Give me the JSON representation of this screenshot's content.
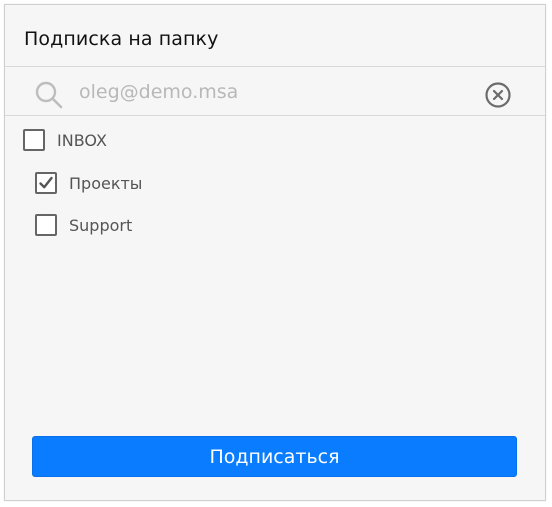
{
  "dialog": {
    "title": "Подписка на папку"
  },
  "search": {
    "value": "oleg@demo.msa",
    "icon": "search-icon",
    "clear_icon": "clear-circle-icon"
  },
  "folders": [
    {
      "label": "INBOX",
      "checked": false
    },
    {
      "label": "Проекты",
      "checked": true
    },
    {
      "label": "Support",
      "checked": false
    }
  ],
  "actions": {
    "subscribe_label": "Подписаться"
  },
  "colors": {
    "accent": "#0a7cff",
    "panel_bg": "#f6f6f6",
    "checkbox_border": "#666666"
  }
}
